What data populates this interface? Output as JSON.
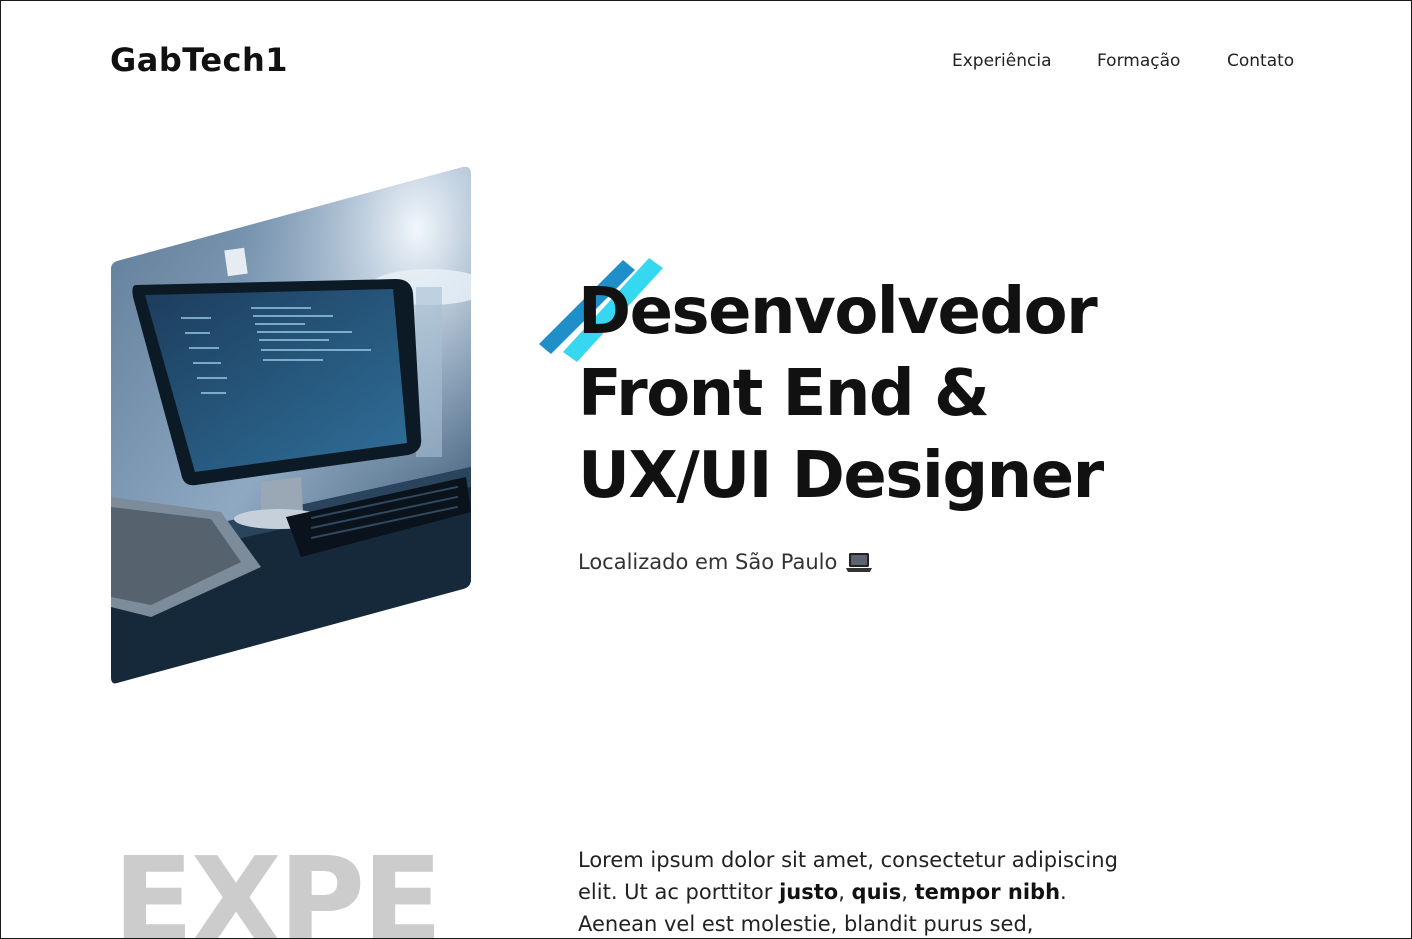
{
  "header": {
    "logo": "GabTech1",
    "nav": [
      {
        "label": "Experiência"
      },
      {
        "label": "Formação"
      },
      {
        "label": "Contato"
      }
    ]
  },
  "hero": {
    "headline_lines": [
      "Desenvolvedor",
      "Front End &",
      "UX/UI Designer"
    ],
    "location": "Localizado em São Paulo",
    "location_icon": "laptop-icon",
    "image_alt": "computer-desk-photo",
    "accent_colors": [
      "#1e8fc9",
      "#36d7f0"
    ]
  },
  "experience": {
    "heading_partial": "EXPE",
    "paragraph": {
      "t1": "Lorem ipsum dolor sit amet, consectetur adipiscing elit. Ut ac porttitor ",
      "b1": "justo",
      "t2": ", ",
      "b2": "quis",
      "t3": ", ",
      "b3": "tempor nibh",
      "t4": ". Aenean vel est molestie, blandit purus sed,"
    }
  }
}
